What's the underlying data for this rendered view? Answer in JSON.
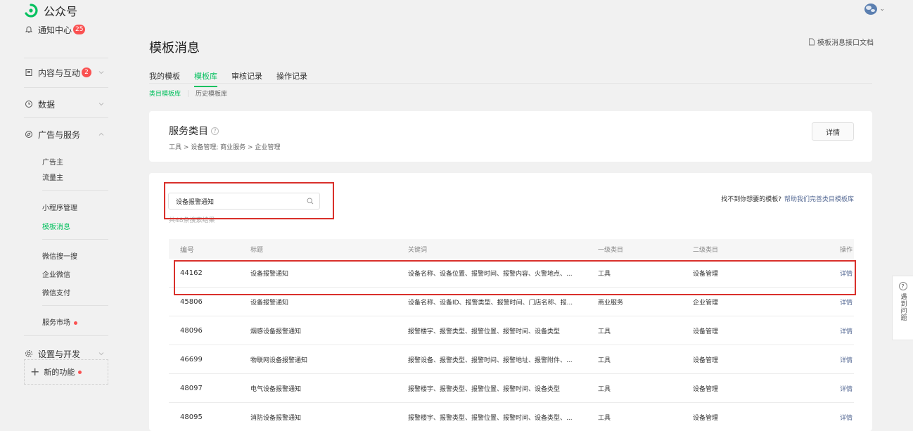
{
  "topbar": {
    "brand_name": "公众号"
  },
  "sidebar": {
    "notify": {
      "label": "通知中心",
      "badge": "25"
    },
    "content": {
      "label": "内容与互动",
      "badge": "2"
    },
    "data": {
      "label": "数据"
    },
    "ads": {
      "label": "广告与服务",
      "items": [
        "广告主",
        "流量主"
      ]
    },
    "group2": [
      "小程序管理",
      "模板消息"
    ],
    "group3": [
      "微信搜一搜",
      "企业微信",
      "微信支付"
    ],
    "market": "服务市场",
    "settings": {
      "label": "设置与开发"
    },
    "new_feature": "新的功能"
  },
  "main": {
    "title": "模板消息",
    "doc_link": "模板消息接口文档",
    "tabs": [
      "我的模板",
      "模板库",
      "审核记录",
      "操作记录"
    ],
    "active_tab": "模板库",
    "subtabs": [
      "类目模板库",
      "历史模板库"
    ],
    "service": {
      "title": "服务类目",
      "path": "工具 > 设备管理; 商业服务 > 企业管理",
      "detail_button": "详情"
    },
    "search": {
      "value": "设备报警通知",
      "result_count": "共48条搜索结果",
      "help_prefix": "找不到你想要的模板?",
      "help_link": "帮助我们完善类目模板库"
    },
    "table": {
      "headers": {
        "id": "编号",
        "title": "标题",
        "keywords": "关键词",
        "level1": "一级类目",
        "level2": "二级类目",
        "op": "操作"
      },
      "rows": [
        {
          "id": "44162",
          "title": "设备报警通知",
          "keywords": "设备名称、设备位置、报警时间、报警内容、火警地点、...",
          "level1": "工具",
          "level2": "设备管理",
          "op": "详情"
        },
        {
          "id": "45806",
          "title": "设备报警通知",
          "keywords": "设备名称、设备ID、报警类型、报警时间、门店名称、报...",
          "level1": "商业服务",
          "level2": "企业管理",
          "op": "详情"
        },
        {
          "id": "48096",
          "title": "烟感设备报警通知",
          "keywords": "报警楼宇、报警类型、报警位置、报警时间、设备类型",
          "level1": "工具",
          "level2": "设备管理",
          "op": "详情"
        },
        {
          "id": "46699",
          "title": "物联网设备报警通知",
          "keywords": "报警设备、报警类型、报警时间、报警地址、报警附件、...",
          "level1": "工具",
          "level2": "设备管理",
          "op": "详情"
        },
        {
          "id": "48097",
          "title": "电气设备报警通知",
          "keywords": "报警楼宇、报警类型、报警位置、报警时间、设备类型",
          "level1": "工具",
          "level2": "设备管理",
          "op": "详情"
        },
        {
          "id": "48095",
          "title": "消防设备报警通知",
          "keywords": "报警楼宇、报警类型、报警位置、报警时间、设备类型、...",
          "level1": "工具",
          "level2": "设备管理",
          "op": "详情"
        }
      ]
    }
  },
  "float_help": {
    "label": "遇到问题"
  },
  "colors": {
    "accent": "#07c160",
    "link": "#576b95",
    "badge": "#fa5151",
    "highlight": "#d9302b"
  }
}
